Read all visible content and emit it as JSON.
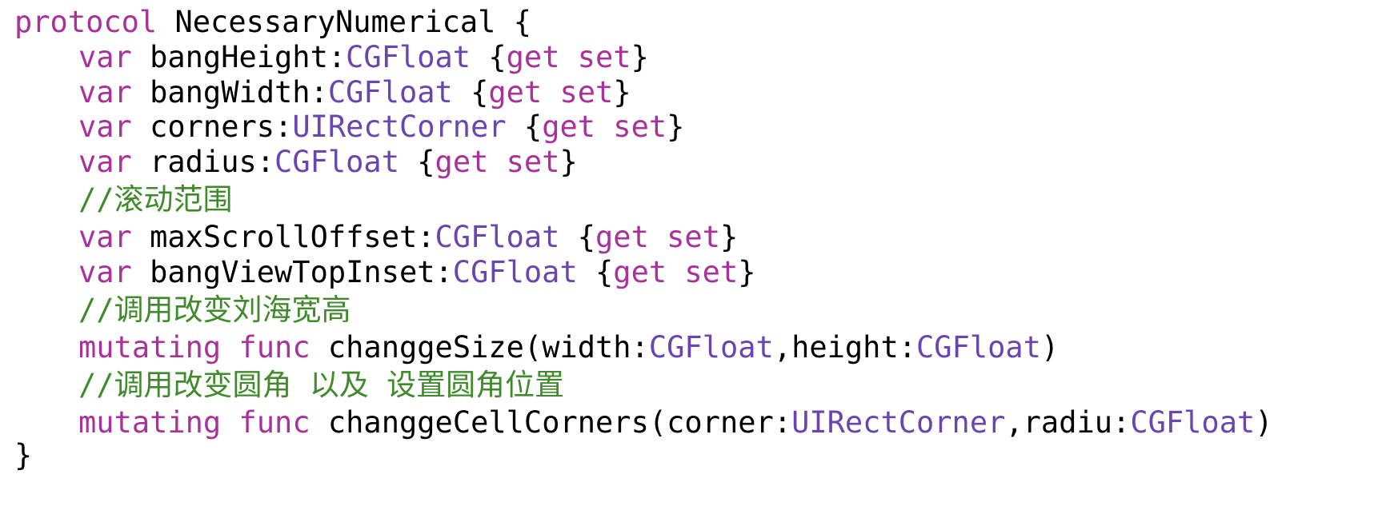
{
  "colors": {
    "keyword": "#A8329A",
    "type": "#6A45B0",
    "comment": "#3F8A2A",
    "plain": "#000000",
    "background": "#FFFFFF"
  },
  "lines": [
    {
      "indent": 0,
      "tokens": [
        {
          "t": "protocol",
          "k": "keyword"
        },
        {
          "t": " NecessaryNumerical {",
          "k": "plain"
        }
      ]
    },
    {
      "indent": 1,
      "tokens": [
        {
          "t": "var",
          "k": "keyword"
        },
        {
          "t": " bangHeight:",
          "k": "plain"
        },
        {
          "t": "CGFloat",
          "k": "type"
        },
        {
          "t": " {",
          "k": "plain"
        },
        {
          "t": "get",
          "k": "keyword"
        },
        {
          "t": " ",
          "k": "plain"
        },
        {
          "t": "set",
          "k": "keyword"
        },
        {
          "t": "}",
          "k": "plain"
        }
      ]
    },
    {
      "indent": 1,
      "tokens": [
        {
          "t": "var",
          "k": "keyword"
        },
        {
          "t": " bangWidth:",
          "k": "plain"
        },
        {
          "t": "CGFloat",
          "k": "type"
        },
        {
          "t": " {",
          "k": "plain"
        },
        {
          "t": "get",
          "k": "keyword"
        },
        {
          "t": " ",
          "k": "plain"
        },
        {
          "t": "set",
          "k": "keyword"
        },
        {
          "t": "}",
          "k": "plain"
        }
      ]
    },
    {
      "indent": 1,
      "tokens": [
        {
          "t": "var",
          "k": "keyword"
        },
        {
          "t": " corners:",
          "k": "plain"
        },
        {
          "t": "UIRectCorner",
          "k": "type"
        },
        {
          "t": " {",
          "k": "plain"
        },
        {
          "t": "get",
          "k": "keyword"
        },
        {
          "t": " ",
          "k": "plain"
        },
        {
          "t": "set",
          "k": "keyword"
        },
        {
          "t": "}",
          "k": "plain"
        }
      ]
    },
    {
      "indent": 1,
      "tokens": [
        {
          "t": "var",
          "k": "keyword"
        },
        {
          "t": " radius:",
          "k": "plain"
        },
        {
          "t": "CGFloat",
          "k": "type"
        },
        {
          "t": " {",
          "k": "plain"
        },
        {
          "t": "get",
          "k": "keyword"
        },
        {
          "t": " ",
          "k": "plain"
        },
        {
          "t": "set",
          "k": "keyword"
        },
        {
          "t": "}",
          "k": "plain"
        }
      ]
    },
    {
      "indent": 1,
      "tokens": [
        {
          "t": "//滚动范围",
          "k": "comment"
        }
      ]
    },
    {
      "indent": 1,
      "tokens": [
        {
          "t": "var",
          "k": "keyword"
        },
        {
          "t": " maxScrollOffset:",
          "k": "plain"
        },
        {
          "t": "CGFloat",
          "k": "type"
        },
        {
          "t": " {",
          "k": "plain"
        },
        {
          "t": "get",
          "k": "keyword"
        },
        {
          "t": " ",
          "k": "plain"
        },
        {
          "t": "set",
          "k": "keyword"
        },
        {
          "t": "}",
          "k": "plain"
        }
      ]
    },
    {
      "indent": 1,
      "tokens": [
        {
          "t": "var",
          "k": "keyword"
        },
        {
          "t": " bangViewTopInset:",
          "k": "plain"
        },
        {
          "t": "CGFloat",
          "k": "type"
        },
        {
          "t": " {",
          "k": "plain"
        },
        {
          "t": "get",
          "k": "keyword"
        },
        {
          "t": " ",
          "k": "plain"
        },
        {
          "t": "set",
          "k": "keyword"
        },
        {
          "t": "}",
          "k": "plain"
        }
      ]
    },
    {
      "indent": 1,
      "tokens": [
        {
          "t": "//调用改变刘海宽高",
          "k": "comment"
        }
      ]
    },
    {
      "indent": 1,
      "tokens": [
        {
          "t": "mutating",
          "k": "keyword"
        },
        {
          "t": " ",
          "k": "plain"
        },
        {
          "t": "func",
          "k": "keyword"
        },
        {
          "t": " changgeSize(width:",
          "k": "plain"
        },
        {
          "t": "CGFloat",
          "k": "type"
        },
        {
          "t": ",height:",
          "k": "plain"
        },
        {
          "t": "CGFloat",
          "k": "type"
        },
        {
          "t": ")",
          "k": "plain"
        }
      ]
    },
    {
      "indent": 1,
      "tokens": [
        {
          "t": "//调用改变圆角 以及 设置圆角位置",
          "k": "comment"
        }
      ]
    },
    {
      "indent": 1,
      "tokens": [
        {
          "t": "mutating",
          "k": "keyword"
        },
        {
          "t": " ",
          "k": "plain"
        },
        {
          "t": "func",
          "k": "keyword"
        },
        {
          "t": " changgeCellCorners(corner:",
          "k": "plain"
        },
        {
          "t": "UIRectCorner",
          "k": "type"
        },
        {
          "t": ",radiu:",
          "k": "plain"
        },
        {
          "t": "CGFloat",
          "k": "type"
        },
        {
          "t": ")",
          "k": "plain"
        }
      ]
    },
    {
      "indent": 0,
      "tokens": [
        {
          "t": "}",
          "k": "plain"
        }
      ]
    }
  ]
}
